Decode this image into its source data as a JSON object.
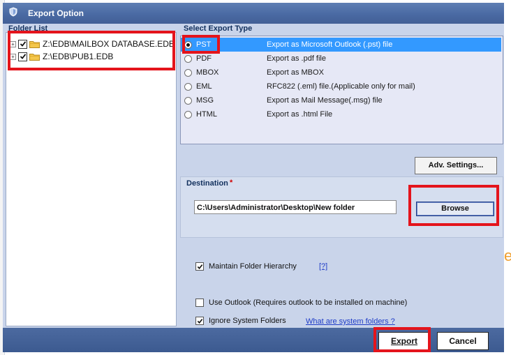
{
  "dialog": {
    "title": "Export Option",
    "title_icon": "shield-icon",
    "colors": {
      "titlebar": "#4a6aa3",
      "panel": "#c9d4ea",
      "selection": "#3399ff",
      "highlight_box": "#e4141c",
      "link": "#1f3cc7"
    }
  },
  "folder_list": {
    "label": "Folder List",
    "items": [
      {
        "path": "Z:\\EDB\\MAILBOX DATABASE.EDB",
        "checked": true,
        "icon": "folder-icon"
      },
      {
        "path": "Z:\\EDB\\PUB1.EDB",
        "checked": true,
        "icon": "folder-icon"
      }
    ]
  },
  "export_type": {
    "label": "Select Export Type",
    "selected": "PST",
    "options": [
      {
        "name": "PST",
        "description": "Export as Microsoft Outlook (.pst) file"
      },
      {
        "name": "PDF",
        "description": "Export as .pdf file"
      },
      {
        "name": "MBOX",
        "description": "Export as MBOX"
      },
      {
        "name": "EML",
        "description": "RFC822 (.eml) file.(Applicable only for mail)"
      },
      {
        "name": "MSG",
        "description": "Export as Mail Message(.msg) file"
      },
      {
        "name": "HTML",
        "description": "Export as .html File"
      }
    ]
  },
  "advanced": {
    "button_label": "Adv. Settings..."
  },
  "destination": {
    "label": "Destination",
    "required_mark": "*",
    "path": "C:\\Users\\Administrator\\Desktop\\New folder",
    "browse_label": "Browse"
  },
  "options": {
    "maintain_hierarchy": {
      "label": "Maintain Folder Hierarchy",
      "checked": true,
      "help_link": "[?]"
    },
    "use_outlook": {
      "label": "Use Outlook (Requires outlook to be installed on machine)",
      "checked": false
    },
    "ignore_system": {
      "label": "Ignore System Folders",
      "checked": true,
      "help_link": "What are system folders ?"
    }
  },
  "footer": {
    "export_label": "Export",
    "cancel_label": "Cancel"
  },
  "background": {
    "right_edge_glyph": "e"
  }
}
